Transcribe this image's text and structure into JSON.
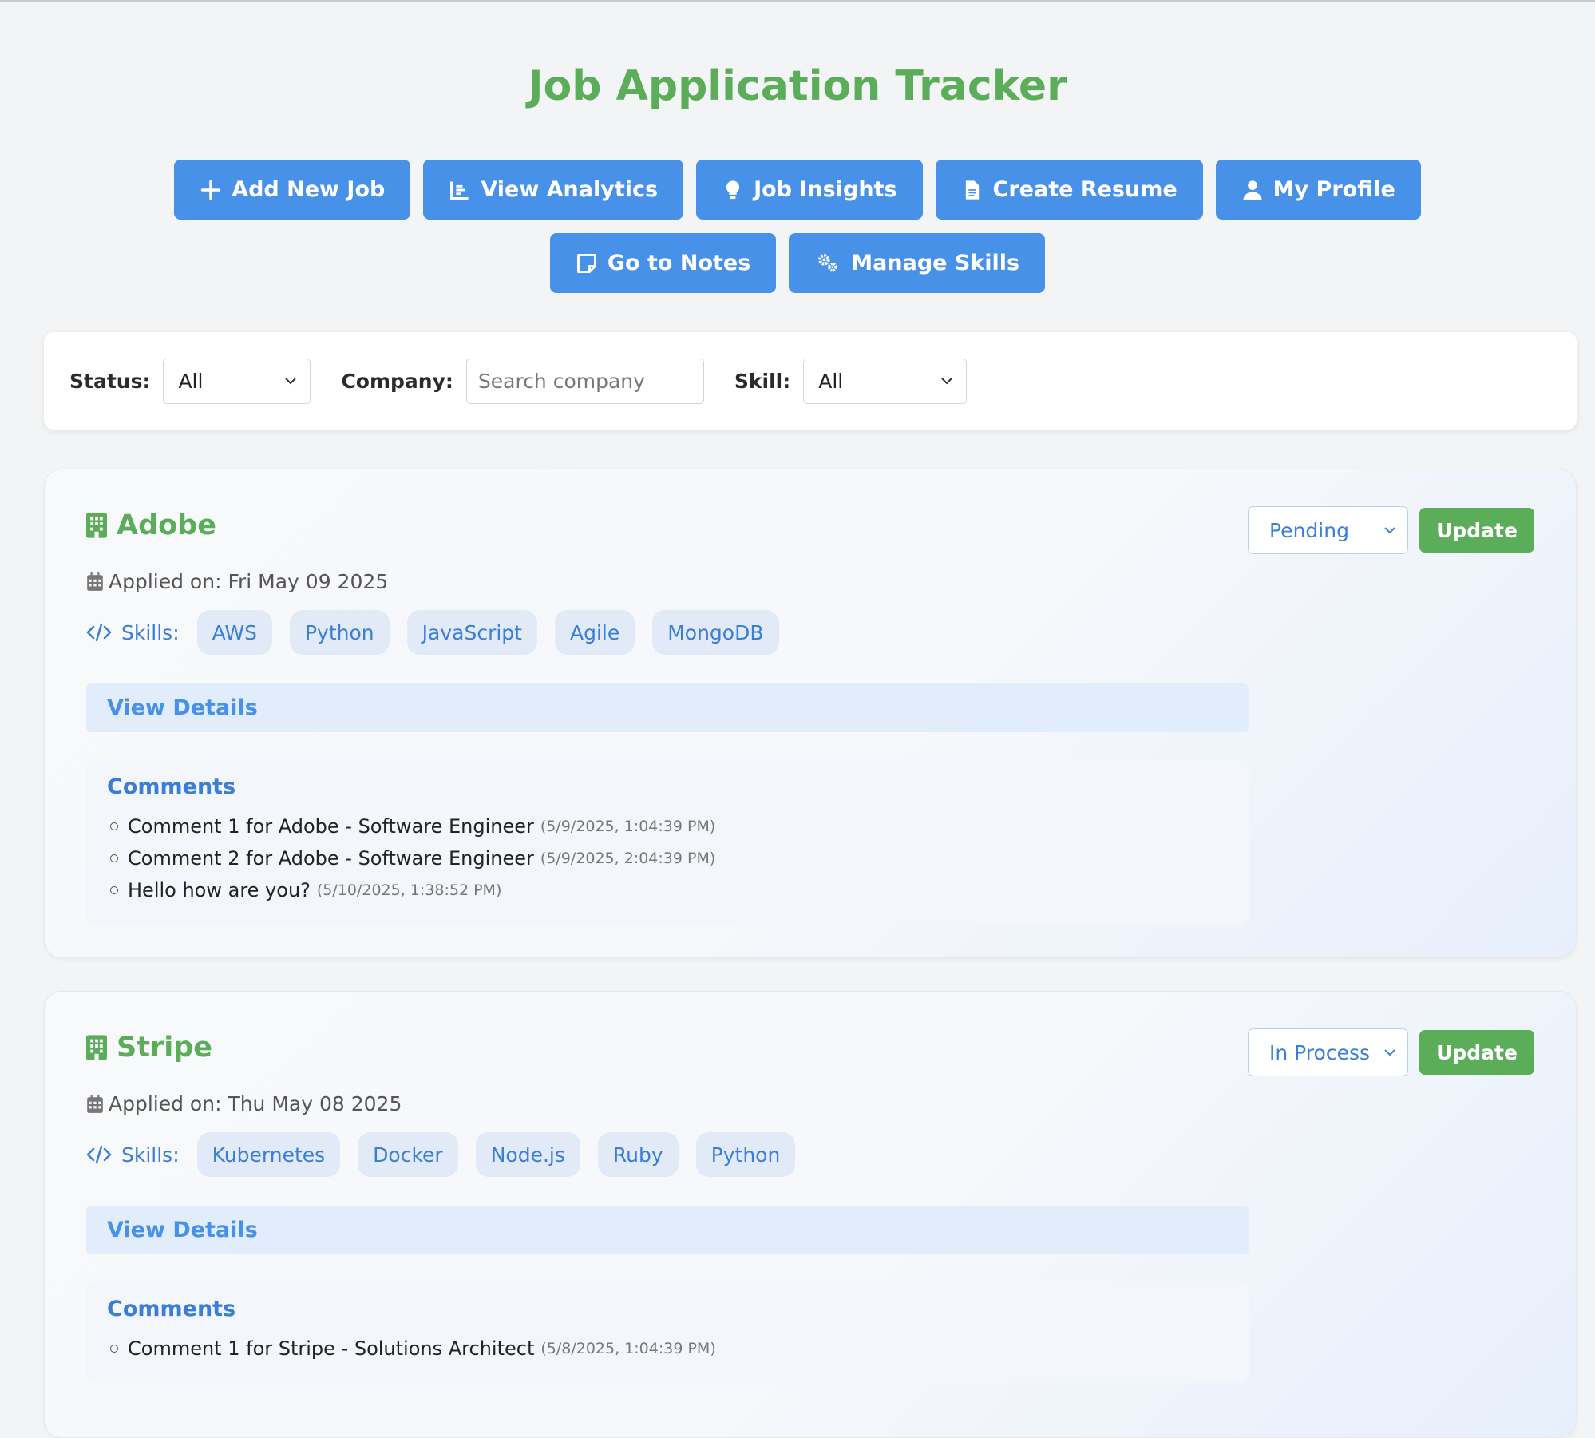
{
  "title": "Job Application Tracker",
  "toolbar": [
    {
      "label": "Add New Job",
      "icon": "plus-icon"
    },
    {
      "label": "View Analytics",
      "icon": "chart-icon"
    },
    {
      "label": "Job Insights",
      "icon": "lightbulb-icon"
    },
    {
      "label": "Create Resume",
      "icon": "document-icon"
    },
    {
      "label": "My Profile",
      "icon": "user-icon"
    },
    {
      "label": "Go to Notes",
      "icon": "note-icon"
    },
    {
      "label": "Manage Skills",
      "icon": "gears-icon"
    }
  ],
  "filters": {
    "status_label": "Status:",
    "status_value": "All",
    "company_label": "Company:",
    "company_placeholder": "Search company",
    "skill_label": "Skill:",
    "skill_value": "All"
  },
  "jobs": [
    {
      "company": "Adobe",
      "applied": "Applied on: Fri May 09 2025",
      "skills_label": "Skills:",
      "skills": [
        "AWS",
        "Python",
        "JavaScript",
        "Agile",
        "MongoDB"
      ],
      "details_label": "View Details",
      "comments_title": "Comments",
      "comments": [
        {
          "text": "Comment 1 for Adobe - Software Engineer",
          "time": "(5/9/2025, 1:04:39 PM)"
        },
        {
          "text": "Comment 2 for Adobe - Software Engineer",
          "time": "(5/9/2025, 2:04:39 PM)"
        },
        {
          "text": "Hello how are you?",
          "time": "(5/10/2025, 1:38:52 PM)"
        }
      ],
      "status": "Pending",
      "update_label": "Update"
    },
    {
      "company": "Stripe",
      "applied": "Applied on: Thu May 08 2025",
      "skills_label": "Skills:",
      "skills": [
        "Kubernetes",
        "Docker",
        "Node.js",
        "Ruby",
        "Python"
      ],
      "details_label": "View Details",
      "comments_title": "Comments",
      "comments": [
        {
          "text": "Comment 1 for Stripe - Solutions Architect",
          "time": "(5/8/2025, 1:04:39 PM)"
        }
      ],
      "status": "In Process",
      "update_label": "Update"
    }
  ],
  "colors": {
    "brand_green": "#5cad59",
    "primary_blue": "#4791e8",
    "link_blue": "#3a7ed8",
    "background": "#f3f4f5"
  }
}
